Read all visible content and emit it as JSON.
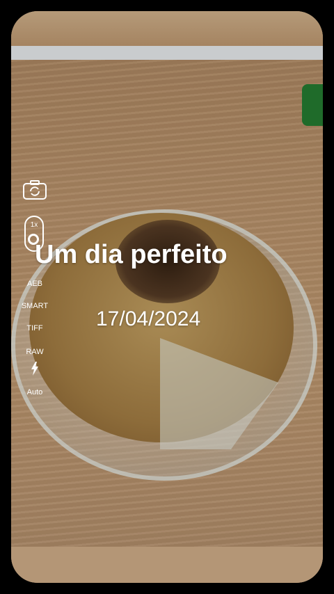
{
  "overlay": {
    "title": "Um dia perfeito",
    "date": "17/04/2024"
  },
  "controls": {
    "zoom_label": "1x",
    "modes": [
      "AEB",
      "SMART",
      "TIFF",
      "RAW"
    ],
    "flash_label": "Auto",
    "icons": [
      "switch-camera-icon",
      "zoom-knob-icon",
      "flash-icon"
    ]
  },
  "colors": {
    "text": "#ffffff",
    "background": "#000000"
  }
}
